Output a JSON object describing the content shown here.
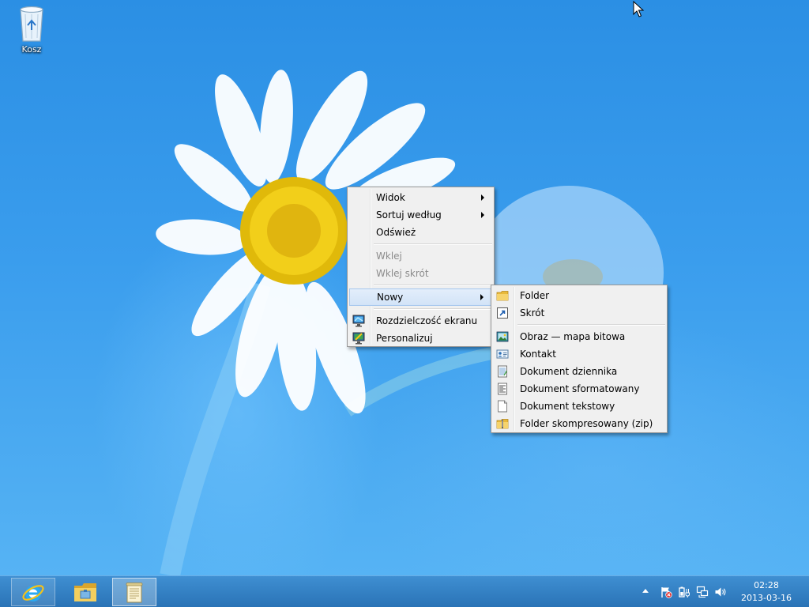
{
  "desktop": {
    "recycle_bin_label": "Kosz"
  },
  "context_menu": {
    "view": "Widok",
    "sort_by": "Sortuj według",
    "refresh": "Odśwież",
    "paste": "Wklej",
    "paste_shortcut": "Wklej skrót",
    "new": "Nowy",
    "screen_resolution": "Rozdzielczość ekranu",
    "personalize": "Personalizuj"
  },
  "new_submenu": {
    "folder": "Folder",
    "shortcut": "Skrót",
    "bitmap": "Obraz — mapa bitowa",
    "contact": "Kontakt",
    "journal": "Dokument dziennika",
    "rtf": "Dokument sformatowany",
    "text": "Dokument tekstowy",
    "zip": "Folder skompresowany (zip)"
  },
  "taskbar": {
    "pinned": [
      "internet-explorer-icon",
      "file-explorer-icon",
      "notepad-icon"
    ],
    "tray_icons": [
      "action-center-flag-icon",
      "power-icon",
      "network-icon",
      "speaker-icon"
    ]
  },
  "clock": {
    "time": "02:28",
    "date": "2013-03-16"
  },
  "colors": {
    "wallpaper": "#3a9ded",
    "taskbar": "#2f7bc0",
    "menu_bg": "#f0f0f0",
    "menu_highlight": "#d9e8f9"
  }
}
